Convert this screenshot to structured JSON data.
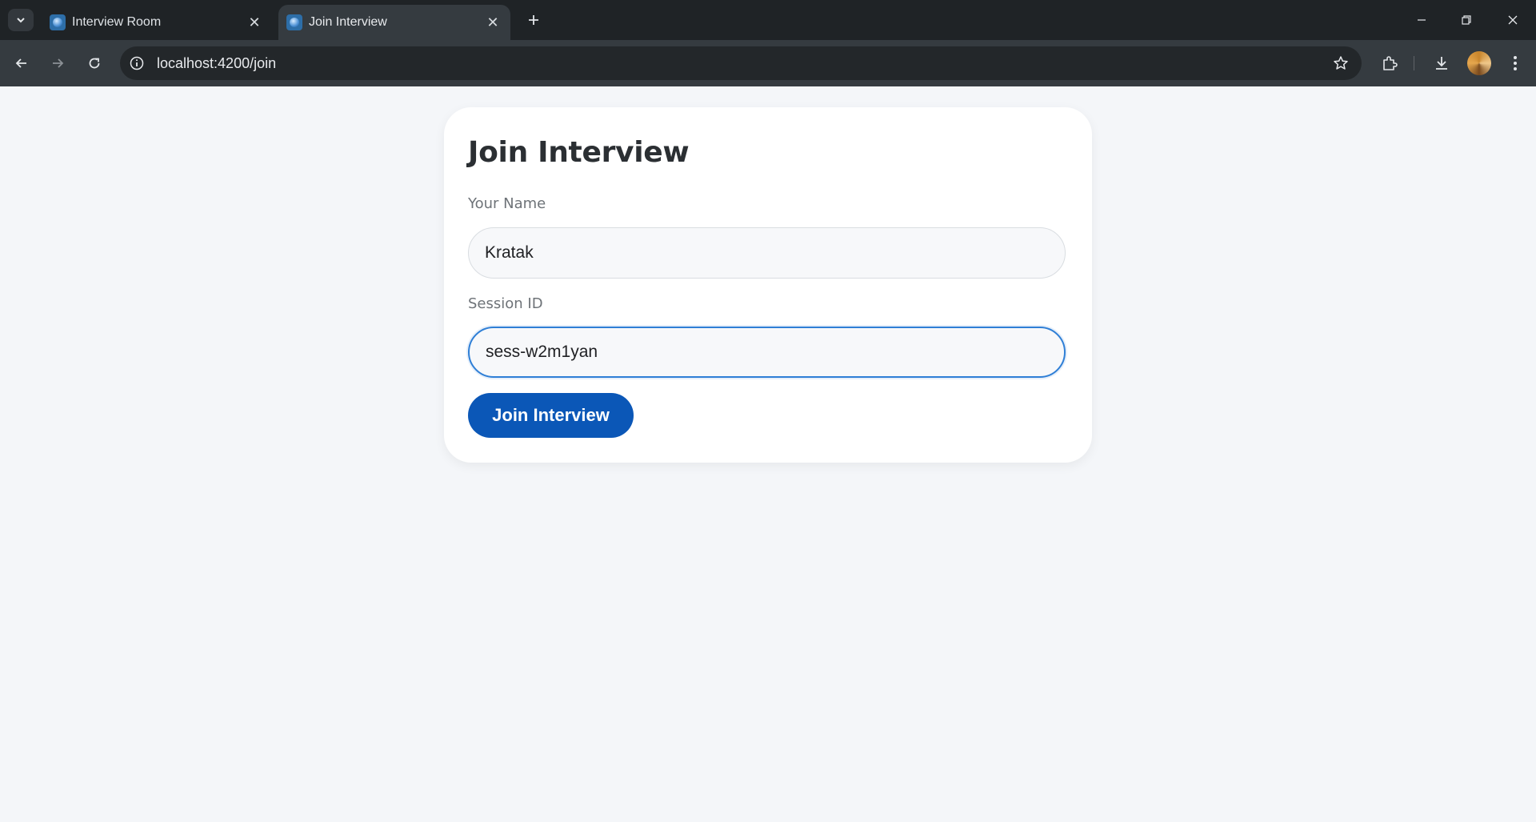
{
  "browser": {
    "tabs": [
      {
        "title": "Interview Room",
        "active": false
      },
      {
        "title": "Join Interview",
        "active": true
      }
    ],
    "url": "localhost:4200/join"
  },
  "page": {
    "heading": "Join Interview",
    "name_label": "Your Name",
    "name_value": "Kratak",
    "session_label": "Session ID",
    "session_value": "sess-w2m1yan",
    "join_button": "Join Interview"
  },
  "colors": {
    "primary": "#0b57b7",
    "focus_border": "#2f7fd6",
    "page_bg": "#f4f6f9"
  }
}
